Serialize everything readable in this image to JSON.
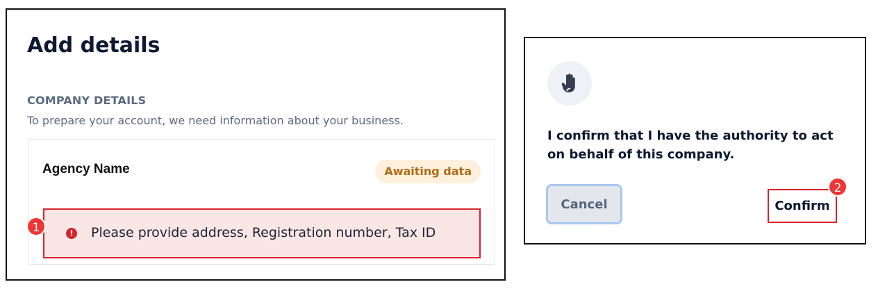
{
  "left_panel": {
    "title": "Add details",
    "section_heading": "COMPANY DETAILS",
    "section_description": "To prepare your account, we need information about your business.",
    "card": {
      "name": "Agency Name",
      "status_badge": "Awaiting data",
      "alert_icon": "error-icon",
      "alert_text": "Please provide address, Registration number, Tax ID"
    },
    "step_marker": "1"
  },
  "right_panel": {
    "icon": "raised-hand-icon",
    "confirm_text": "I confirm that I have the authority to act on behalf of this company.",
    "cancel_label": "Cancel",
    "confirm_label": "Confirm",
    "step_marker": "2"
  },
  "colors": {
    "alert_border": "#d7232b",
    "alert_background": "#fbe6e6",
    "badge_background": "#fdf0dc",
    "badge_text": "#b06a14",
    "marker": "#ef3535"
  }
}
